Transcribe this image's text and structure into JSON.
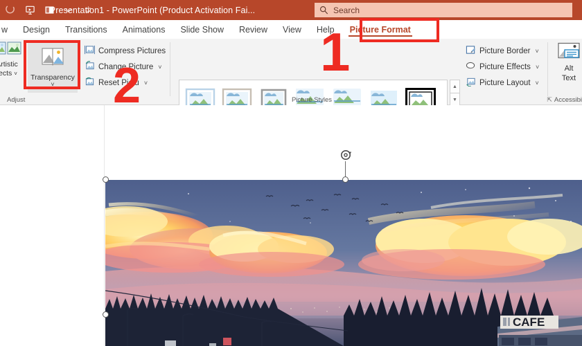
{
  "titlebar": {
    "title": "Presentation1  -  PowerPoint (Product Activation Fai...",
    "bg_color": "#b7472a",
    "qat": [
      {
        "name": "save-icon",
        "label": "Save"
      },
      {
        "name": "present-icon",
        "label": "Start Presentation"
      },
      {
        "name": "slideshow-icon",
        "label": "Slide Show"
      },
      {
        "name": "undo-dropdown-icon",
        "label": "Undo"
      },
      {
        "name": "customize-qat-icon",
        "label": "Customize Quick Access Toolbar"
      }
    ]
  },
  "search": {
    "placeholder": "Search",
    "value": "",
    "icon": "search-icon"
  },
  "tabs": [
    {
      "label": "w",
      "active": false
    },
    {
      "label": "Design",
      "active": false
    },
    {
      "label": "Transitions",
      "active": false
    },
    {
      "label": "Animations",
      "active": false
    },
    {
      "label": "Slide Show",
      "active": false
    },
    {
      "label": "Review",
      "active": false
    },
    {
      "label": "View",
      "active": false
    },
    {
      "label": "Help",
      "active": false
    },
    {
      "label": "Picture Format",
      "active": true
    }
  ],
  "ribbon": {
    "accent_color": "#b7472a",
    "groups": [
      {
        "label": "Adjust"
      },
      {
        "label": "Picture Styles"
      },
      {
        "label": "Accessibi"
      }
    ],
    "adjust": {
      "artistic_effects": {
        "label_line1": "Artistic",
        "label_line2": "fects",
        "icon": "artistic-effects-icon",
        "has_chevron": true
      },
      "transparency": {
        "label": "Transparency",
        "icon": "transparency-icon",
        "has_chevron": true,
        "highlighted": true
      },
      "commands": [
        {
          "label": "Compress Pictures",
          "icon": "compress-pictures-icon",
          "has_chevron": false
        },
        {
          "label": "Change Picture",
          "icon": "change-picture-icon",
          "has_chevron": true
        },
        {
          "label": "Reset Pictu",
          "icon": "reset-picture-icon",
          "has_chevron": true
        }
      ]
    },
    "picture_styles": {
      "label": "Picture Styles",
      "thumbnails": [
        {
          "name": "style-simple-frame-white",
          "selected": false
        },
        {
          "name": "style-beveled-matte-white",
          "selected": false
        },
        {
          "name": "style-metal-frame",
          "selected": false
        },
        {
          "name": "style-drop-shadow-rectangle",
          "selected": false
        },
        {
          "name": "style-reflected-rounded-rectangle",
          "selected": false
        },
        {
          "name": "style-soft-edge-rectangle",
          "selected": false
        },
        {
          "name": "style-double-frame-black",
          "selected": true
        }
      ],
      "scroll_buttons": [
        {
          "name": "gallery-scroll-up-button",
          "glyph": "▲"
        },
        {
          "name": "gallery-scroll-down-button",
          "glyph": "▼"
        },
        {
          "name": "gallery-more-button",
          "glyph": "≡"
        }
      ]
    },
    "picture_commands": [
      {
        "label": "Picture Border",
        "icon": "picture-border-icon",
        "has_chevron": true
      },
      {
        "label": "Picture Effects",
        "icon": "picture-effects-icon",
        "has_chevron": true
      },
      {
        "label": "Picture Layout",
        "icon": "picture-layout-icon",
        "has_chevron": true
      }
    ],
    "alt_text": {
      "line1": "Alt",
      "line2": "Text",
      "icon": "alt-text-icon"
    },
    "accessibility": {
      "label": "Accessibi",
      "launcher_icon": "dialog-launcher-icon"
    }
  },
  "slide": {
    "picture": {
      "name": "sunset-clouds-painting",
      "sign_text": "CAFE",
      "selected": true,
      "handles": [
        "top-left",
        "top-center",
        "middle-left",
        "rotation"
      ]
    }
  },
  "annotations": [
    {
      "name": "annotation-number-1",
      "text": "1",
      "color": "#ee2b22"
    },
    {
      "name": "annotation-number-2",
      "text": "2",
      "color": "#ee2b22"
    },
    {
      "name": "annotation-box-picture-format",
      "color": "#ee2b22"
    },
    {
      "name": "annotation-box-transparency",
      "color": "#ee2b22"
    }
  ]
}
